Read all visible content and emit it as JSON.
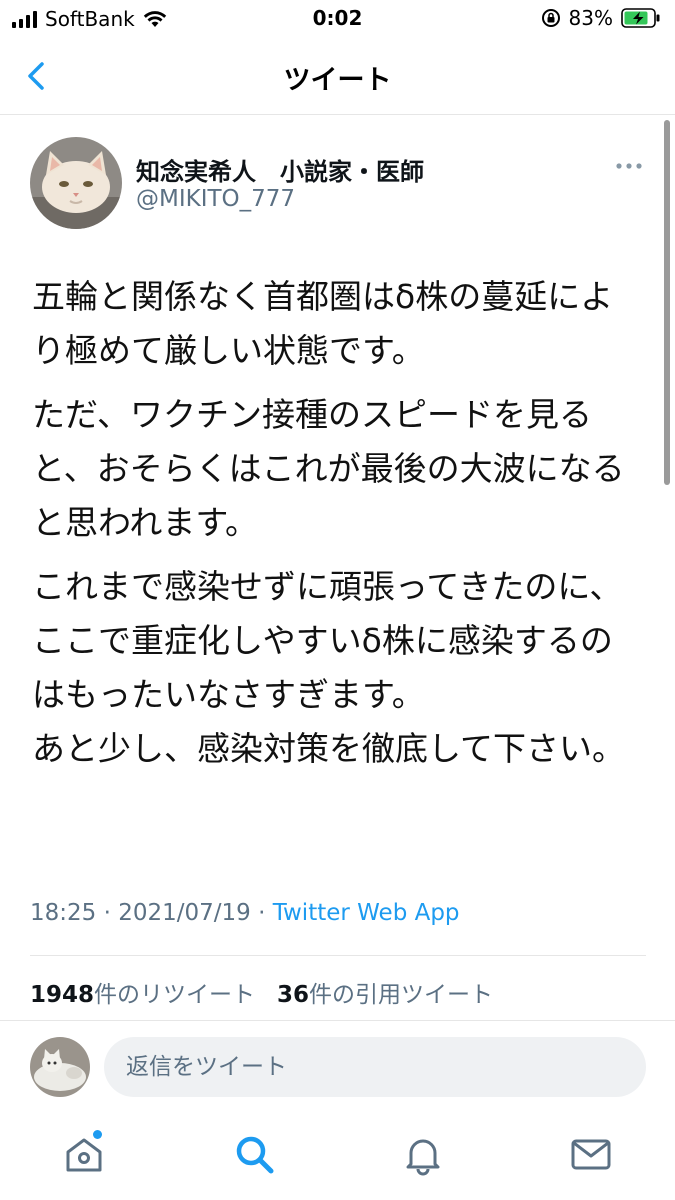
{
  "status_bar": {
    "carrier": "SoftBank",
    "time": "0:02",
    "battery_percent": "83%"
  },
  "header": {
    "title": "ツイート"
  },
  "tweet": {
    "author_name": "知念実希人　小説家・医師",
    "author_handle": "@MIKITO_777",
    "paragraphs": [
      "五輪と関係なく首都圏はδ株の蔓延により極めて厳しい状態です。",
      "ただ、ワクチン接種のスピードを見ると、おそらくはこれが最後の大波になると思われます。",
      "これまで感染せずに頑張ってきたのに、ここで重症化しやすいδ株に感染するのはもったいなさすぎます。\nあと少し、感染対策を徹底して下さい。"
    ],
    "time": "18:25",
    "separator": "·",
    "date": "2021/07/19",
    "source": "Twitter Web App",
    "retweet_count": "1948",
    "retweet_label": "件のリツイート",
    "quote_count": "36",
    "quote_label": "件の引用ツイート"
  },
  "reply": {
    "placeholder": "返信をツイート"
  },
  "tab_bar": {
    "items": [
      "home-icon",
      "search-icon",
      "notifications-icon",
      "messages-icon"
    ],
    "active_color": "#1d9bf0"
  },
  "colors": {
    "accent": "#1d9bf0",
    "secondary_text": "#5b7083"
  }
}
